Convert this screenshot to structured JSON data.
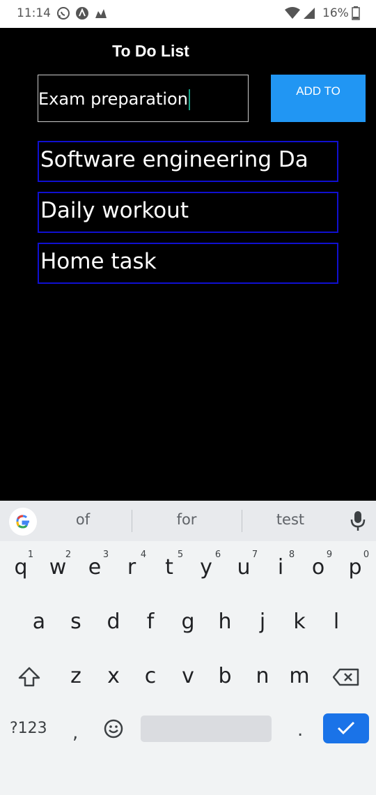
{
  "status_bar": {
    "time": "11:14",
    "battery": "16%",
    "icons": [
      "whatsapp-icon",
      "app-icon",
      "vlc-icon",
      "wifi-icon",
      "signal-icon",
      "battery-icon"
    ]
  },
  "app": {
    "title": "To Do List",
    "input_value": "Exam preparation",
    "add_button_label": "ADD TO",
    "items": [
      {
        "label": "Software engineering Da"
      },
      {
        "label": "Daily workout"
      },
      {
        "label": "Home task"
      }
    ],
    "accent_color": "#2196f3",
    "item_border_color": "#1010d0"
  },
  "keyboard": {
    "suggestions": [
      "of",
      "for",
      "test"
    ],
    "row1": [
      "q",
      "w",
      "e",
      "r",
      "t",
      "y",
      "u",
      "i",
      "o",
      "p"
    ],
    "row1_hints": [
      "1",
      "2",
      "3",
      "4",
      "5",
      "6",
      "7",
      "8",
      "9",
      "0"
    ],
    "row2": [
      "a",
      "s",
      "d",
      "f",
      "g",
      "h",
      "j",
      "k",
      "l"
    ],
    "row3": [
      "z",
      "x",
      "c",
      "v",
      "b",
      "n",
      "m"
    ],
    "symbols_key": "?123",
    "comma_key": ",",
    "period_key": ".",
    "icons": [
      "google-icon",
      "mic-icon",
      "shift-icon",
      "backspace-icon",
      "emoji-icon",
      "check-icon"
    ]
  }
}
